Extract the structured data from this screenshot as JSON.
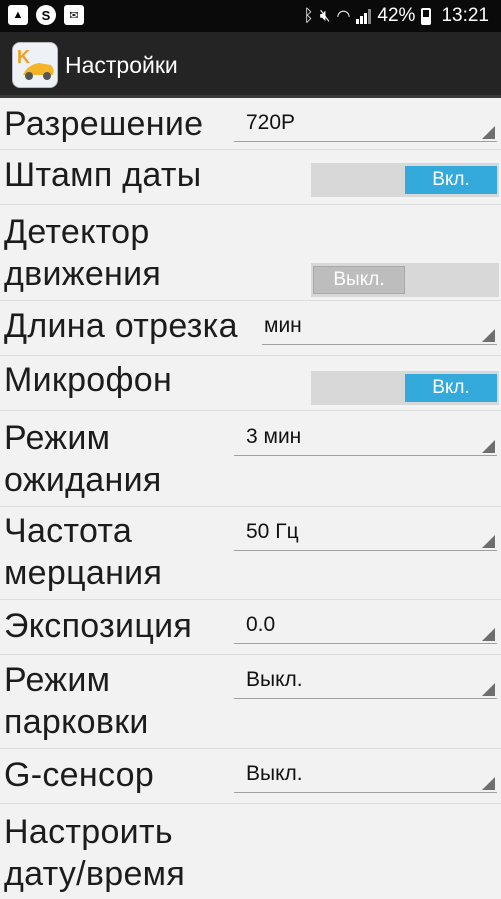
{
  "status": {
    "battery": "42%",
    "time": "13:21"
  },
  "app": {
    "title": "Настройки"
  },
  "settings": [
    {
      "label": "Разрешение",
      "type": "spinner",
      "value": "720P"
    },
    {
      "label": "Штамп даты",
      "type": "toggle",
      "state": "on",
      "value": "Вкл."
    },
    {
      "label": "Детектор\nдвижения",
      "type": "toggle",
      "state": "off",
      "value": "Выкл."
    },
    {
      "label": "Длина отрезка",
      "type": "spinner",
      "value": "мин"
    },
    {
      "label": "Микрофон",
      "type": "toggle",
      "state": "on",
      "value": "Вкл."
    },
    {
      "label": "Режим\nожидания",
      "type": "spinner",
      "value": "3 мин"
    },
    {
      "label": "Частота\nмерцания",
      "type": "spinner",
      "value": "50 Гц"
    },
    {
      "label": "Экспозиция",
      "type": "spinner",
      "value": "0.0"
    },
    {
      "label": "Режим\nпарковки",
      "type": "spinner",
      "value": "Выкл."
    },
    {
      "label": "G-сенсор",
      "type": "spinner",
      "value": "Выкл."
    },
    {
      "label": "Настроить\nдату/время",
      "type": "none",
      "value": ""
    }
  ]
}
